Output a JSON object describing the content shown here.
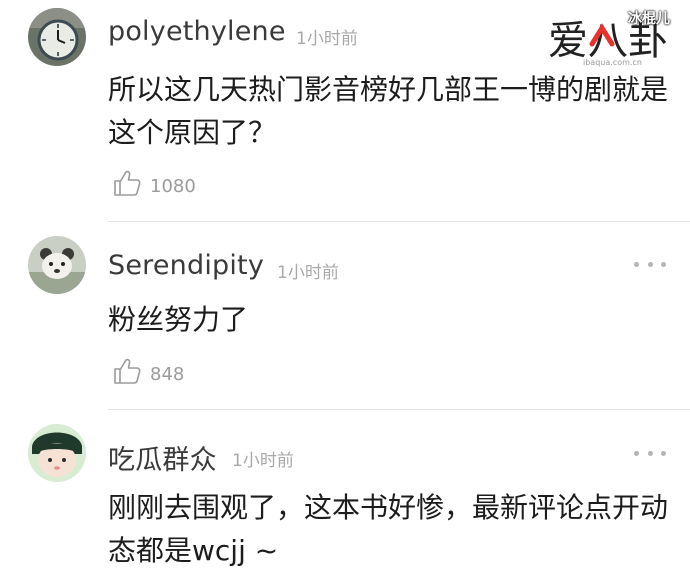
{
  "branding": {
    "logo_text": "爱八卦",
    "logo_url_text": "ibaqua.com.cn",
    "watermark": "冰棍儿"
  },
  "comments": [
    {
      "username": "polyethylene",
      "time": "1小时前",
      "text": "所以这几天热门影音榜好几部王一博的剧就是这个原因了？",
      "likes": "1080",
      "avatar_icon": "clock-icon"
    },
    {
      "username": "Serendipity",
      "time": "1小时前",
      "text": "粉丝努力了",
      "likes": "848",
      "avatar_icon": "bear-icon"
    },
    {
      "username": "吃瓜群众",
      "time": "1小时前",
      "text": "刚刚去围观了，这本书好惨，最新评论点开动态都是wcjj ~",
      "likes": "",
      "avatar_icon": "cartoon-face-icon"
    }
  ],
  "colors": {
    "username": "#3a3a3a",
    "time": "#a8a8a8",
    "logo_red": "#e8322c"
  }
}
